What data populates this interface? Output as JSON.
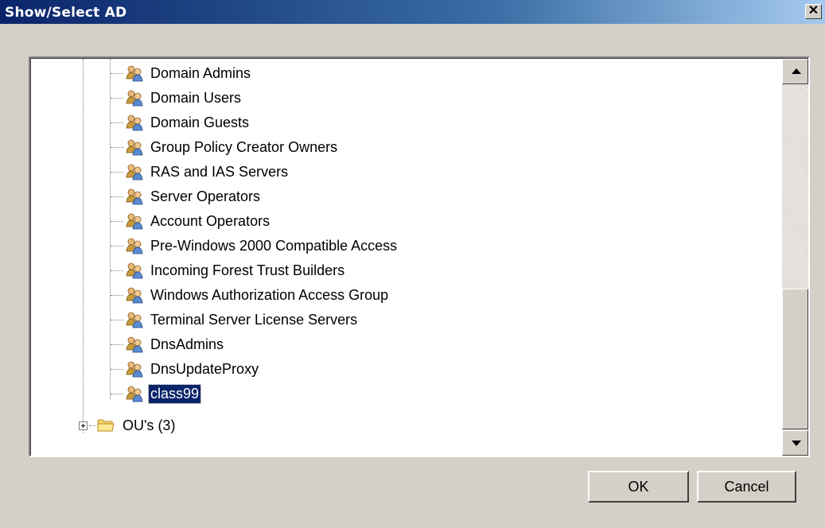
{
  "window": {
    "title": "Show/Select AD",
    "close_glyph": "✕"
  },
  "tree": {
    "groups": [
      "Domain Admins",
      "Domain Users",
      "Domain Guests",
      "Group Policy Creator Owners",
      "RAS and IAS Servers",
      "Server Operators",
      "Account Operators",
      "Pre-Windows 2000 Compatible Access",
      "Incoming Forest Trust Builders",
      "Windows Authorization Access Group",
      "Terminal Server License Servers",
      "DnsAdmins",
      "DnsUpdateProxy",
      "class99"
    ],
    "selected": "class99",
    "group_icon": "user-group-icon",
    "ou_node": {
      "label": "OU's (3)",
      "icon": "folder-icon",
      "expander": "plus-expander-icon"
    }
  },
  "buttons": {
    "ok": "OK",
    "cancel": "Cancel"
  },
  "colors": {
    "title_start": "#0a246a",
    "title_end": "#a6caf0",
    "selection": "#0a246a",
    "dialog_bg": "#d4d0c8"
  }
}
